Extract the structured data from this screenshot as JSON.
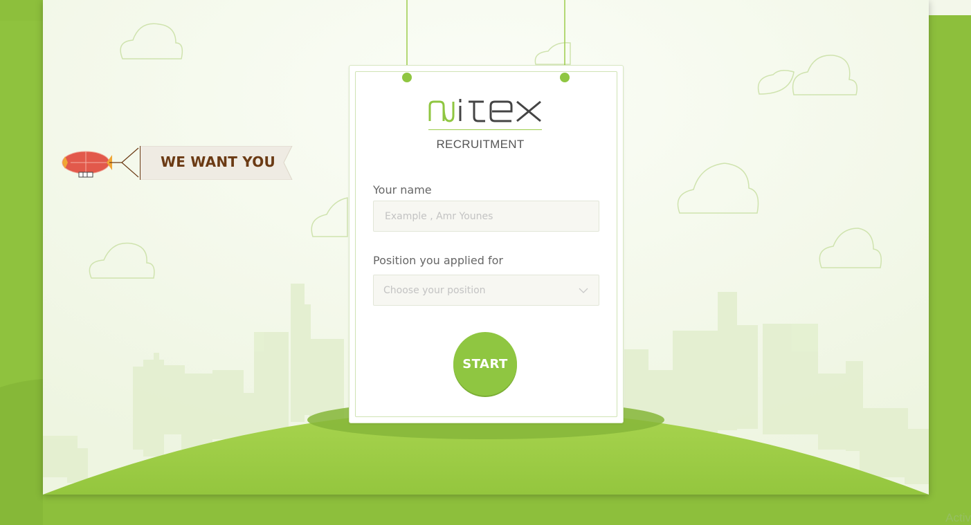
{
  "brand": {
    "logo_text": "nitex",
    "subtitle": "RECRUITMENT"
  },
  "banner": {
    "text": "WE WANT YOU"
  },
  "form": {
    "name_label": "Your name",
    "name_placeholder": "Example , Amr Younes",
    "position_label": "Position you applied for",
    "position_placeholder": "Choose your position",
    "start_label": "START"
  },
  "corner_text": "Activ",
  "colors": {
    "accent": "#8fc641",
    "banner_text": "#6b3a14",
    "hill": "#a3d14b",
    "background": "#8dbf3c"
  }
}
